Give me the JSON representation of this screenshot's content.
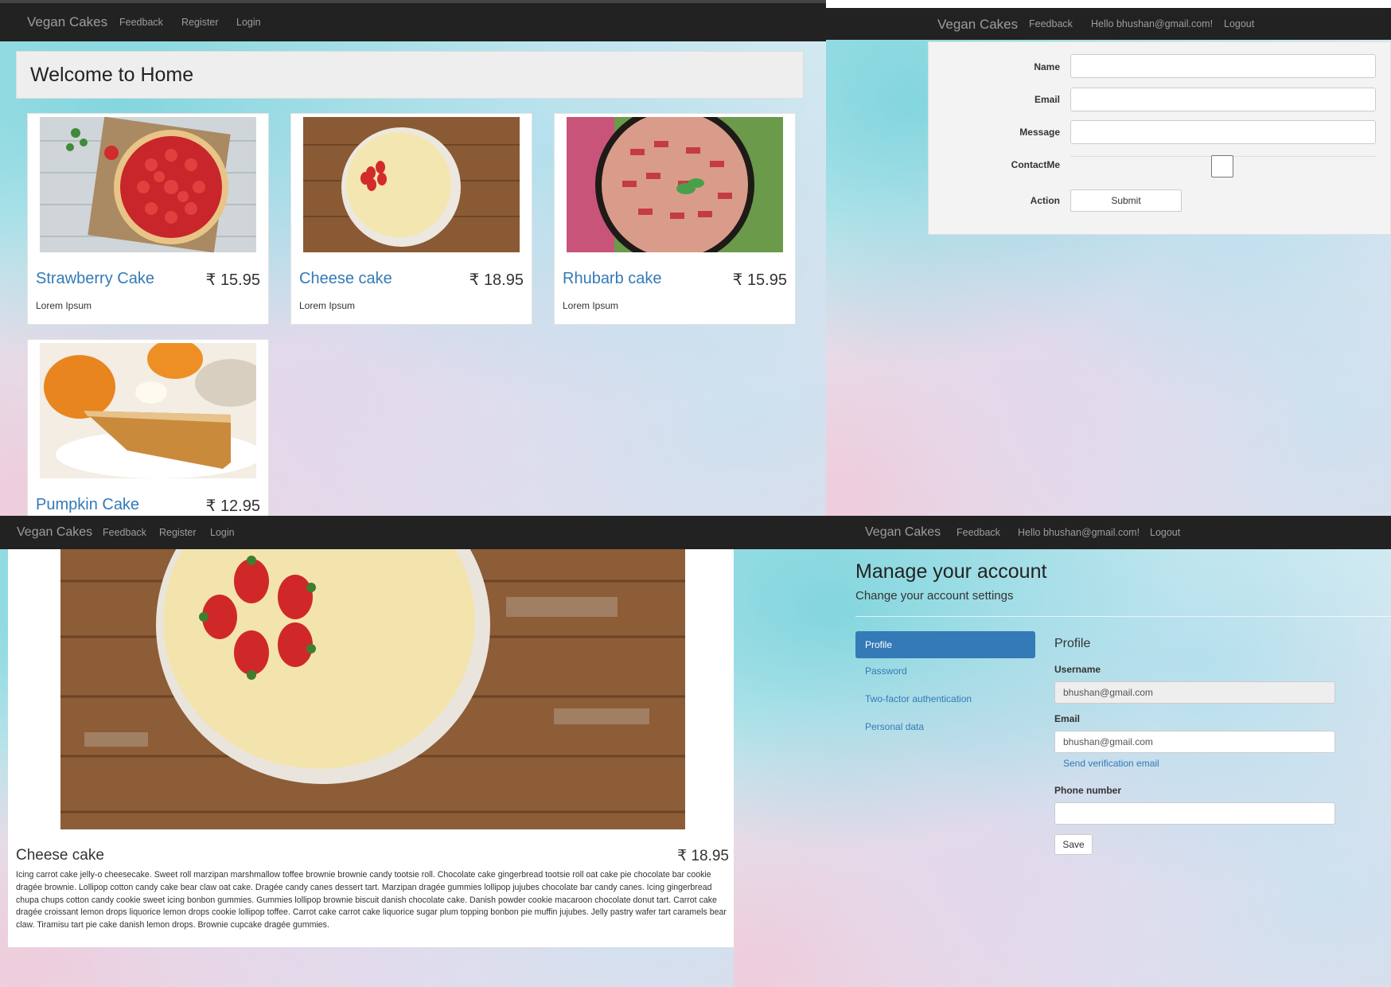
{
  "home": {
    "brand": "Vegan Cakes",
    "nav": [
      "Feedback",
      "Register",
      "Login"
    ],
    "heading": "Welcome to Home",
    "products": [
      {
        "name": "Strawberry Cake",
        "price": "₹ 15.95",
        "desc": "Lorem Ipsum"
      },
      {
        "name": "Cheese cake",
        "price": "₹ 18.95",
        "desc": "Lorem Ipsum"
      },
      {
        "name": "Rhubarb cake",
        "price": "₹ 15.95",
        "desc": "Lorem Ipsum"
      },
      {
        "name": "Pumpkin Cake",
        "price": "₹ 12.95",
        "desc": ""
      }
    ]
  },
  "feedback": {
    "brand": "Vegan Cakes",
    "nav": [
      "Feedback",
      "Hello bhushan@gmail.com!",
      "Logout"
    ],
    "labels": {
      "name": "Name",
      "email": "Email",
      "message": "Message",
      "contact": "ContactMe",
      "action": "Action"
    },
    "submit_label": "Submit"
  },
  "detail": {
    "brand": "Vegan Cakes",
    "nav": [
      "Feedback",
      "Register",
      "Login"
    ],
    "name": "Cheese cake",
    "price": "₹ 18.95",
    "description": "Icing carrot cake jelly-o cheesecake. Sweet roll marzipan marshmallow toffee brownie brownie candy tootsie roll. Chocolate cake gingerbread tootsie roll oat cake pie chocolate bar cookie dragée brownie. Lollipop cotton candy cake bear claw oat cake. Dragée candy canes dessert tart. Marzipan dragée gummies lollipop jujubes chocolate bar candy canes. Icing gingerbread chupa chups cotton candy cookie sweet icing bonbon gummies. Gummies lollipop brownie biscuit danish chocolate cake. Danish powder cookie macaroon chocolate donut tart. Carrot cake dragée croissant lemon drops liquorice lemon drops cookie lollipop toffee. Carrot cake carrot cake liquorice sugar plum topping bonbon pie muffin jujubes. Jelly pastry wafer tart caramels bear claw. Tiramisu tart pie cake danish lemon drops. Brownie cupcake dragée gummies."
  },
  "account": {
    "brand": "Vegan Cakes",
    "nav": [
      "Feedback",
      "Hello bhushan@gmail.com!",
      "Logout"
    ],
    "title": "Manage your account",
    "subtitle": "Change your account settings",
    "sidebar": [
      "Profile",
      "Password",
      "Two-factor authentication",
      "Personal data"
    ],
    "section_title": "Profile",
    "username_label": "Username",
    "username_value": "bhushan@gmail.com",
    "email_label": "Email",
    "email_value": "bhushan@gmail.com",
    "send_verification": "Send verification email",
    "phone_label": "Phone number",
    "phone_value": "",
    "save_label": "Save"
  },
  "colors": {
    "navbar": "#222222",
    "link": "#337ab7",
    "active": "#337ab7"
  }
}
